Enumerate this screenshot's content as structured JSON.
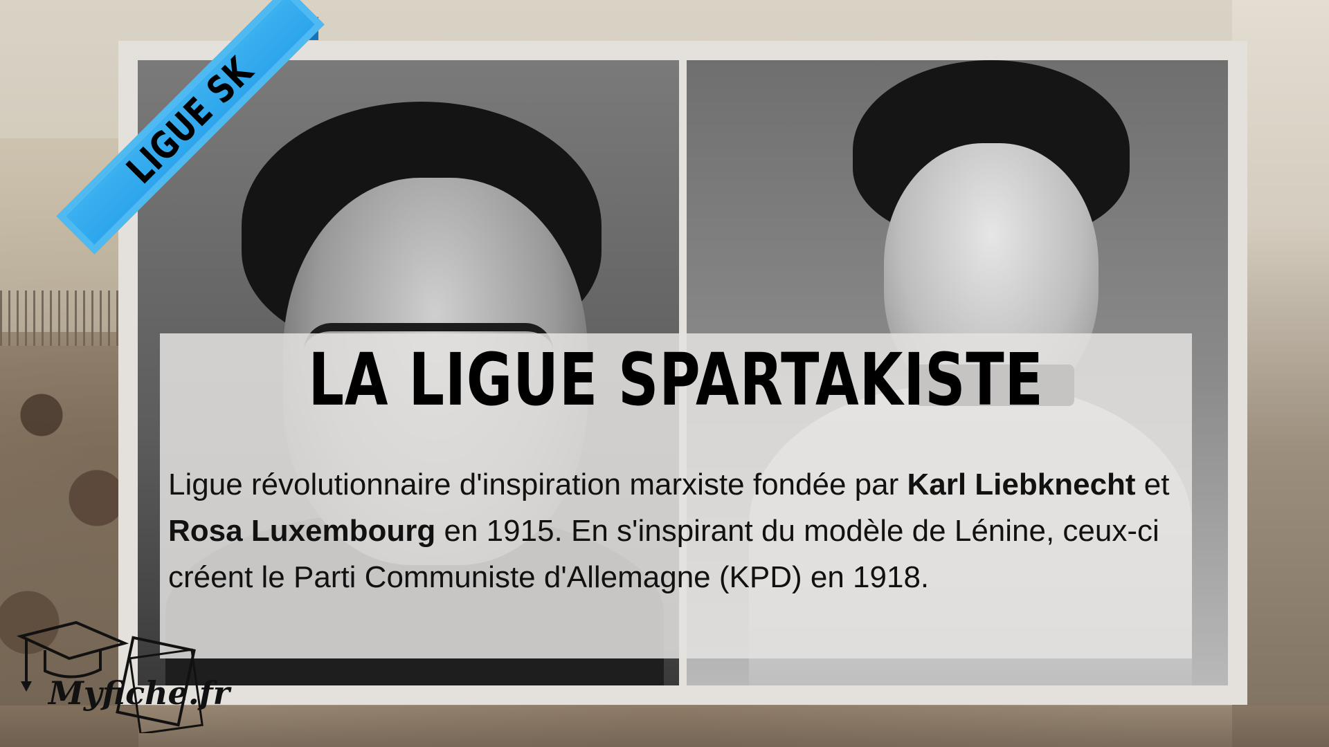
{
  "ribbon": {
    "label": "LIGUE SK"
  },
  "title": "LA LIGUE SPARTAKISTE",
  "description": {
    "p1": "Ligue révolutionnaire d'inspiration marxiste fondée par ",
    "name1": "Karl Liebknecht",
    "p2": " et ",
    "name2": "Rosa Luxembourg",
    "p3": " en 1915. En s'inspirant du modèle de Lénine, ceux-ci créent le Parti Communiste d'Allemagne (KPD) en 1918."
  },
  "logo": {
    "text": "Myfiche.fr"
  },
  "colors": {
    "ribbon": "#2aa4ec",
    "ribbon_dark": "#1673b8",
    "frame": "#e4e1dc",
    "text": "#000000"
  },
  "icons": {
    "logo_icon": "graduation-cap-icon"
  }
}
